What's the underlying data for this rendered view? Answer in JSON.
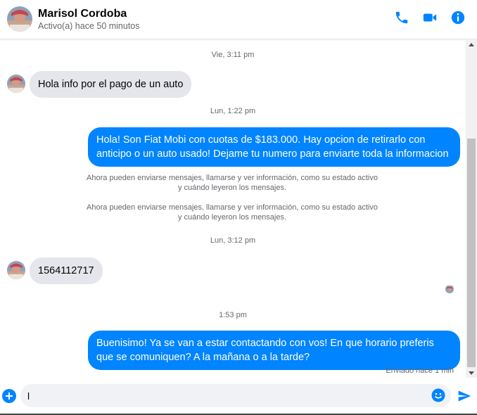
{
  "header": {
    "name": "Marisol Cordoba",
    "status": "Activo(a) hace 50 minutos",
    "icons": [
      "phone-icon",
      "video-camera-icon",
      "info-icon"
    ],
    "accent_color": "#0084ff"
  },
  "messages": {
    "ts1": "Vie, 3:11 pm",
    "in1": "Hola info por el pago de un auto",
    "ts2": "Lun, 1:22 pm",
    "out1": "Hola! Son Fiat Mobi con cuotas de $183.000. Hay opcion de retirarlo con anticipo o un auto usado! Dejame tu numero para enviarte toda la informacion",
    "sys1_line1": "Ahora pueden enviarse mensajes, llamarse y ver información, como su estado activo",
    "sys1_line2": "y cuándo leyeron los mensajes.",
    "sys2_line1": "Ahora pueden enviarse mensajes, llamarse y ver información, como su estado activo",
    "sys2_line2": "y cuándo leyeron los mensajes.",
    "ts3": "Lun, 3:12 pm",
    "in2": "1564112717",
    "ts4": "1:53 pm",
    "out2": "Buenisimo! Ya se van a estar contactando con vos! En que horario preferis que se comuniquen? A la mañana o a la tarde?",
    "sent_status": "Enviado hace 1 min"
  },
  "composer": {
    "value": "l",
    "icons": [
      "plus-circle-icon",
      "emoji-icon",
      "send-icon"
    ]
  }
}
